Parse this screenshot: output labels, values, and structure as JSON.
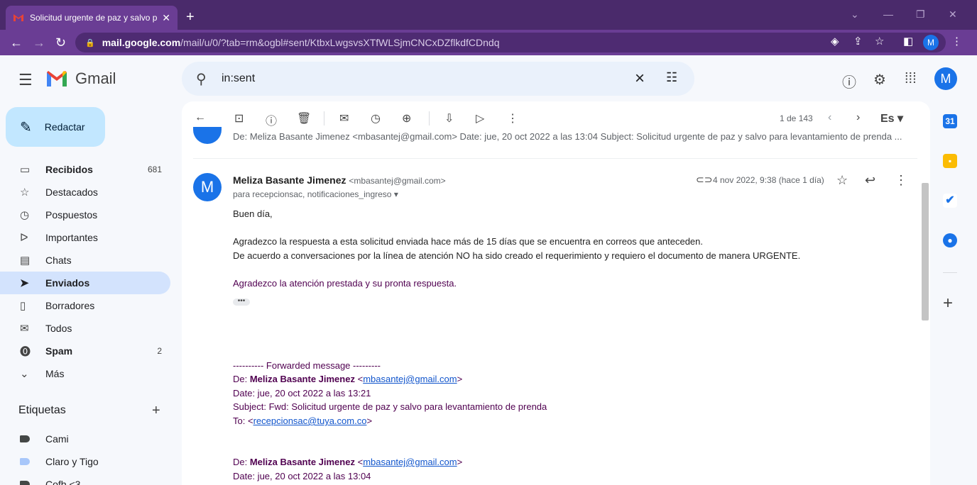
{
  "browser": {
    "tab_title": "Solicitud urgente de paz y salvo p",
    "url_host": "mail.google.com",
    "url_path": "/mail/u/0/?tab=rm&ogbl#sent/KtbxLwgsvsXTfWLSjmCNCxDZflkdfCDndq",
    "profile_initial": "M"
  },
  "header": {
    "brand": "Gmail",
    "search_value": "in:sent",
    "avatar_initial": "M"
  },
  "sidebar": {
    "compose_label": "Redactar",
    "items": [
      {
        "label": "Recibidos",
        "count": "681"
      },
      {
        "label": "Destacados",
        "count": ""
      },
      {
        "label": "Pospuestos",
        "count": ""
      },
      {
        "label": "Importantes",
        "count": ""
      },
      {
        "label": "Chats",
        "count": ""
      },
      {
        "label": "Enviados",
        "count": ""
      },
      {
        "label": "Borradores",
        "count": ""
      },
      {
        "label": "Todos",
        "count": ""
      },
      {
        "label": "Spam",
        "count": "2"
      },
      {
        "label": "Más",
        "count": ""
      }
    ],
    "labels_title": "Etiquetas",
    "labels": [
      {
        "label": "Cami",
        "color": "#444746"
      },
      {
        "label": "Claro y Tigo",
        "color": "#a8c7fa"
      },
      {
        "label": "Cofb <3",
        "color": "#444746"
      }
    ]
  },
  "toolbar": {
    "pager": "1 de 143",
    "lang": "Es"
  },
  "thread": {
    "previous_preview": "De: Meliza Basante Jimenez <mbasantej@gmail.com> Date: jue, 20 oct 2022 a las 13:04 Subject: Solicitud urgente de paz y salvo para levantamiento de prenda ...",
    "message": {
      "avatar_initial": "M",
      "sender_name": "Meliza Basante Jimenez",
      "sender_email": "<mbasantej@gmail.com>",
      "to_line": "para recepcionsac, notificaciones_ingreso",
      "date": "4 nov 2022, 9:38 (hace 1 día)",
      "greeting": "Buen día,",
      "line1": "Agradezco la respuesta a esta solicitud enviada hace más de 15 días que se encuentra en correos que anteceden.",
      "line2": "De acuerdo a conversaciones por la línea de atención NO ha sido creado el requerimiento y requiero el documento de manera URGENTE.",
      "line3": "Agradezco la atención prestada y su pronta respuesta.",
      "ellipsis": "•••"
    },
    "forwarded": {
      "header": "---------- Forwarded message ---------",
      "de_prefix": "De: ",
      "de_name": "Meliza Basante Jimenez",
      "de_email": "mbasantej@gmail.com",
      "date": "Date: jue, 20 oct 2022 a las 13:21",
      "subject": "Subject: Fwd: Solicitud urgente de paz y salvo para levantamiento de prenda",
      "to_prefix": "To: ",
      "to_email": "recepcionsac@tuya.com.co"
    },
    "forwarded2": {
      "de_prefix": "De: ",
      "de_name": "Meliza Basante Jimenez",
      "de_email": "mbasantej@gmail.com",
      "date": "Date: jue, 20 oct 2022 a las 13:04"
    }
  }
}
